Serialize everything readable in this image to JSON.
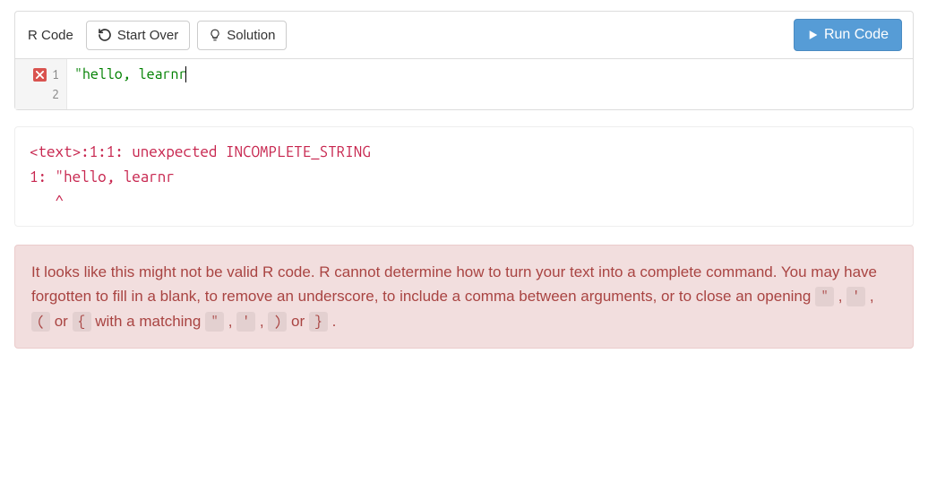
{
  "toolbar": {
    "label": "R Code",
    "start_over": "Start Over",
    "solution": "Solution",
    "run": "Run Code"
  },
  "editor": {
    "line1_num": "1",
    "line2_num": "2",
    "line1_code": "\"hello, learnr"
  },
  "output": {
    "line1": "<text>:1:1: unexpected INCOMPLETE_STRING",
    "line2": "1: \"hello, learnr",
    "line3": "   ^"
  },
  "alert": {
    "p1": "It looks like this might not be valid R code. R cannot determine how to turn your text into a complete command. You may have forgotten to fill in a blank, to remove an underscore, to include a comma between arguments, or to close an opening ",
    "c1": "\"",
    "s1": " , ",
    "c2": "'",
    "s2": " , ",
    "c3": "(",
    "p2": " or ",
    "c4": "{",
    "p3": " with a matching ",
    "c5": "\"",
    "s3": " , ",
    "c6": "'",
    "s4": " , ",
    "c7": ")",
    "p4": " or ",
    "c8": "}",
    "p5": " ."
  }
}
